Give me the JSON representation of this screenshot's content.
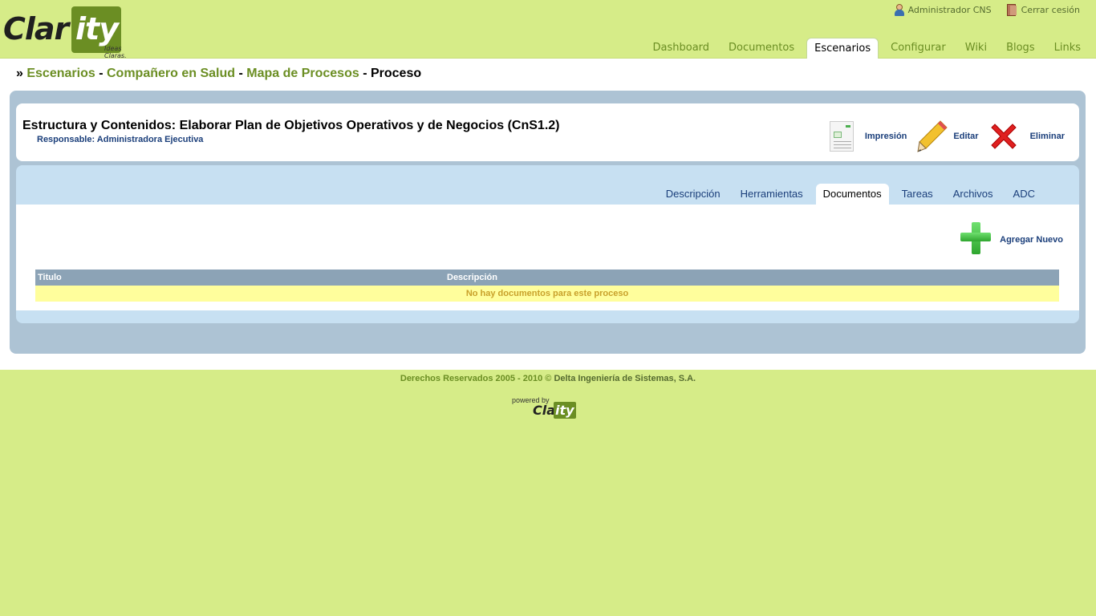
{
  "logo": {
    "part1": "Clar",
    "part2": "ity",
    "tagline": "Ideas Claras."
  },
  "user": {
    "name": "Administrador CNS",
    "logout": "Cerrar cesión"
  },
  "nav": {
    "tabs": [
      "Dashboard",
      "Documentos",
      "Escenarios",
      "Configurar",
      "Wiki",
      "Blogs",
      "Links"
    ],
    "active": "Escenarios"
  },
  "breadcrumb": {
    "prefix": "»",
    "items": [
      "Escenarios",
      "Compañero en Salud",
      "Mapa de Procesos"
    ],
    "current": "Proceso",
    "sep": "-"
  },
  "process": {
    "title": "Estructura y Contenidos: Elaborar Plan de Objetivos Operativos y de Negocios (CnS1.2)",
    "responsible": "Responsable: Administradora Ejecutiva"
  },
  "actions": {
    "print": "Impresión",
    "edit": "Editar",
    "delete": "Eliminar"
  },
  "subtabs": {
    "tabs": [
      "Descripción",
      "Herramientas",
      "Documentos",
      "Tareas",
      "Archivos",
      "ADC"
    ],
    "active": "Documentos"
  },
  "add_new": "Agregar Nuevo",
  "table": {
    "headers": [
      "Titulo",
      "Descripción"
    ],
    "empty_message": "No hay documentos para este proceso"
  },
  "footer": {
    "text": "Derechos Reservados 2005 - 2010 ©",
    "company": "Delta Ingeniería de Sistemas, S.A.",
    "powered_by": "powered by",
    "brand1": "Clar",
    "brand2": "ity"
  },
  "colors": {
    "background": "#d6ec88",
    "accent_green": "#6b8e23",
    "link_blue": "#1a3e7a",
    "panel_blue": "#adc3d4"
  }
}
